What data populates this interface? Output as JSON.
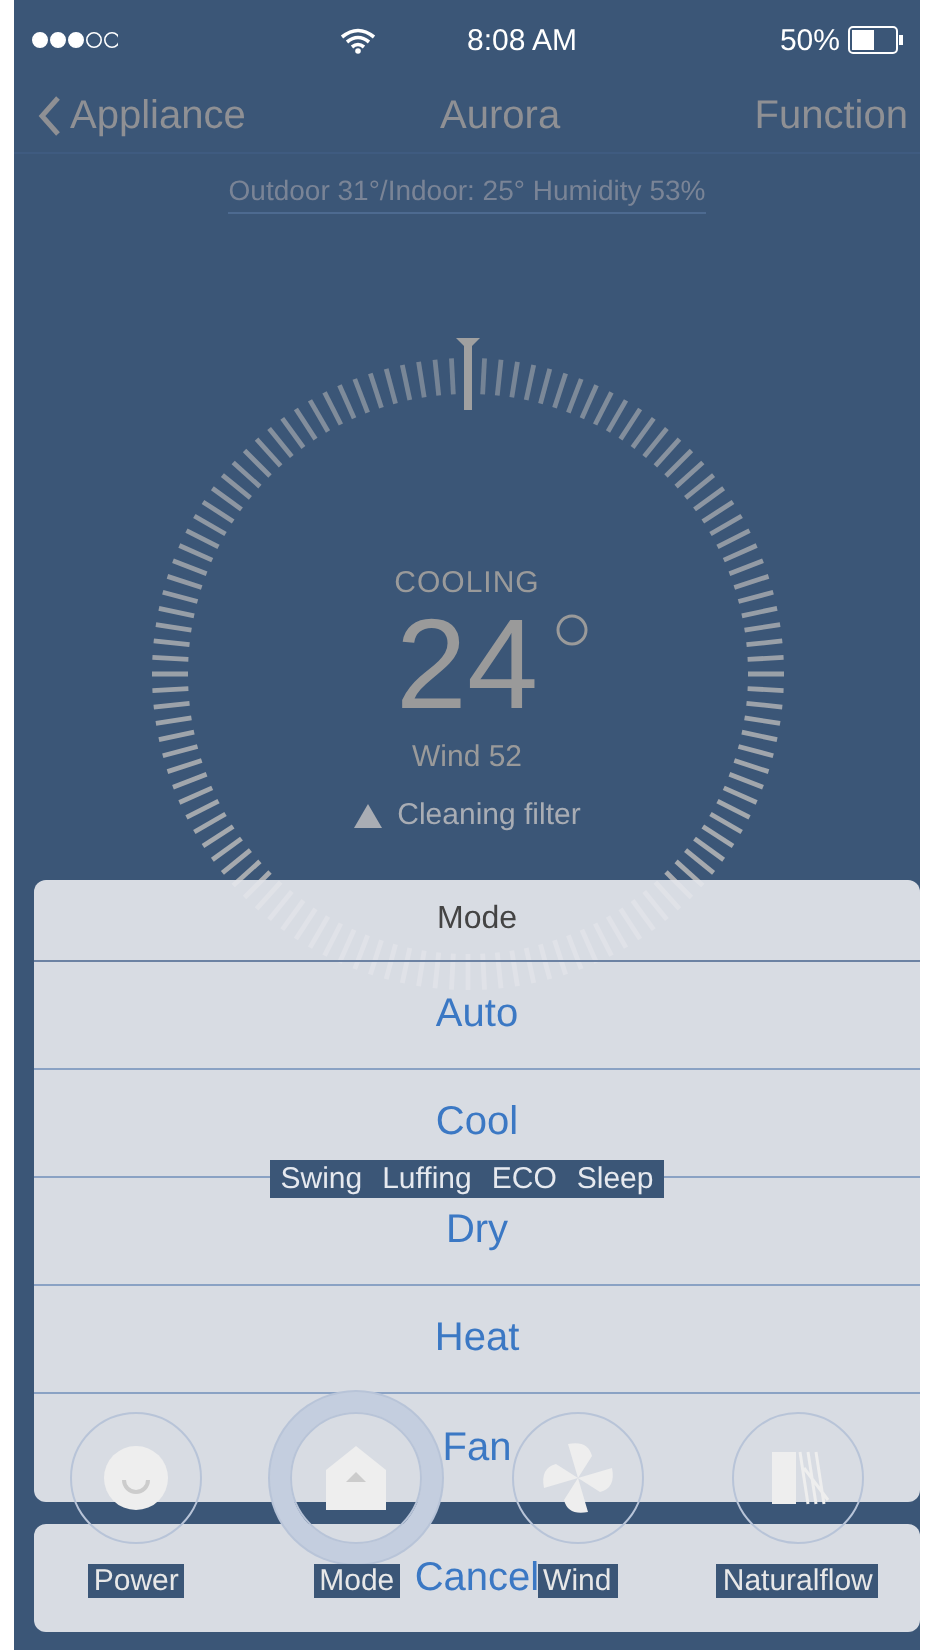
{
  "status_bar": {
    "time": "8:08 AM",
    "battery": "50%"
  },
  "nav": {
    "back": "Appliance",
    "title": "Aurora",
    "action": "Function"
  },
  "info": "Outdoor 31°/Indoor: 25° Humidity 53%",
  "thermostat": {
    "mode": "COOLING",
    "temperature": "24",
    "wind": "Wind 52",
    "alert": "Cleaning filter"
  },
  "features": [
    "Swing",
    "Luffing",
    "ECO",
    "Sleep"
  ],
  "controls": [
    {
      "label": "Power",
      "kind": "power",
      "selected": false
    },
    {
      "label": "Mode",
      "kind": "mode",
      "selected": true
    },
    {
      "label": "Wind",
      "kind": "wind",
      "selected": false
    },
    {
      "label": "Naturalflow",
      "kind": "flow",
      "selected": false
    }
  ],
  "action_sheet": {
    "title": "Mode",
    "options": [
      "Auto",
      "Cool",
      "Dry",
      "Heat",
      "Fan"
    ],
    "cancel": "Cancel"
  }
}
